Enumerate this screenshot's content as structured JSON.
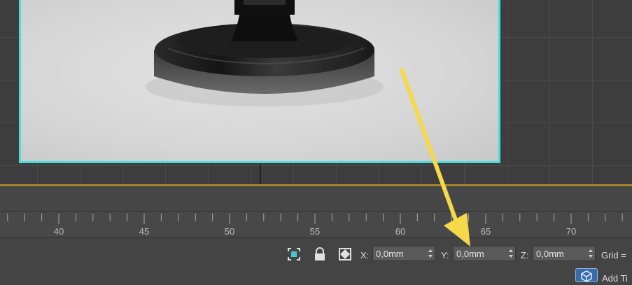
{
  "ruler": {
    "ticks": [
      {
        "label": "40"
      },
      {
        "label": "45"
      },
      {
        "label": "50"
      },
      {
        "label": "55"
      },
      {
        "label": "60"
      },
      {
        "label": "65"
      },
      {
        "label": "70"
      }
    ]
  },
  "status_bar": {
    "x_label": "X:",
    "x_value": "0,0mm",
    "y_label": "Y:",
    "y_value": "0,0mm",
    "z_label": "Z:",
    "z_value": "0,0mm",
    "grid_label": "Grid =",
    "add_time_label": "Add Ti"
  },
  "colors": {
    "selection_border": "#46dede",
    "timeline_accent": "#a0832c",
    "annotation_arrow": "#f5d94a",
    "add_time_button": "#3a6aa8"
  },
  "icons": {
    "selection_icon": "selection-lock-toggle-icon",
    "lock_icon": "lock-icon",
    "transform_icon": "absolute-relative-transform-icon",
    "add_time_icon": "cube-tag-icon"
  }
}
